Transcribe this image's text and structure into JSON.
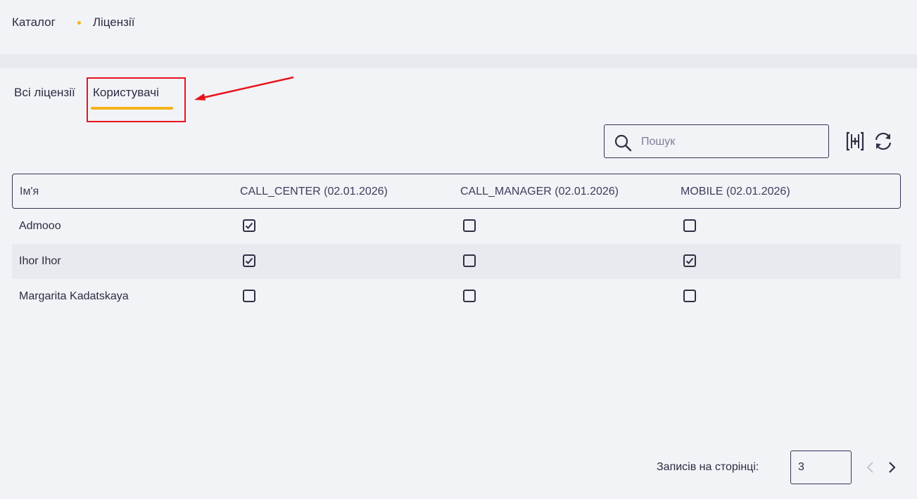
{
  "breadcrumb": {
    "catalog": "Каталог",
    "licenses": "Ліцензії",
    "dot_color": "#f5b21b"
  },
  "tabs": [
    {
      "label": "Всі ліцензії",
      "active": false
    },
    {
      "label": "Користувачі",
      "active": true
    }
  ],
  "search": {
    "placeholder": "Пошук",
    "value": ""
  },
  "toolbar": {
    "icons": [
      "add-column-icon",
      "refresh-icon"
    ]
  },
  "table": {
    "headers": [
      "Ім'я",
      "CALL_CENTER (02.01.2026)",
      "CALL_MANAGER (02.01.2026)",
      "MOBILE (02.01.2026)"
    ],
    "rows": [
      {
        "name": "Admooo",
        "checks": [
          true,
          false,
          false
        ]
      },
      {
        "name": "Ihor Ihor",
        "checks": [
          true,
          false,
          true
        ]
      },
      {
        "name": "Margarita Kadatskaya",
        "checks": [
          false,
          false,
          false
        ]
      }
    ]
  },
  "pagination": {
    "label": "Записів на сторінці:",
    "per_page": "3"
  },
  "colors": {
    "accent": "#f5b21b",
    "annotation": "#e8141d",
    "border": "#2f3657",
    "background": "#f2f3f7"
  }
}
